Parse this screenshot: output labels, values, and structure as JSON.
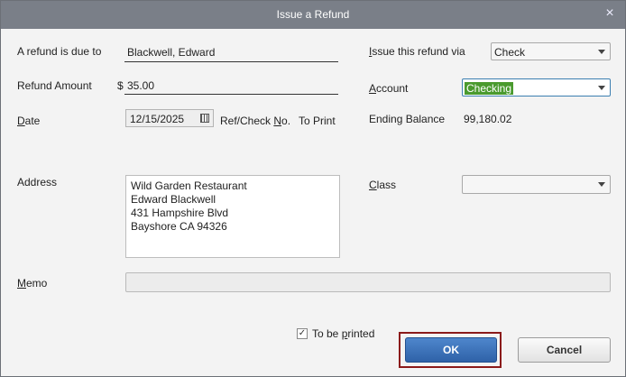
{
  "window": {
    "title": "Issue a Refund",
    "close_glyph": "×"
  },
  "form": {
    "refund_due_label": "A refund is due to",
    "refund_due_value": "Blackwell, Edward",
    "amount_label": "Refund Amount",
    "currency": "$",
    "amount_value": "35.00",
    "date_label_u": "D",
    "date_label_rest": "ate",
    "date_value": "12/15/2025",
    "ref_label_pre": "Ref/Check ",
    "ref_label_u": "N",
    "ref_label_post": "o.",
    "ref_value": "To Print",
    "address_label": "Address",
    "address_lines": [
      "Wild Garden Restaurant",
      "Edward Blackwell",
      "431 Hampshire Blvd",
      "Bayshore CA 94326"
    ],
    "memo_label_u": "M",
    "memo_label_rest": "emo",
    "memo_value": "",
    "issue_via_label_u": "I",
    "issue_via_label_rest": "ssue this refund via",
    "issue_via_value": "Check",
    "account_label_u": "A",
    "account_label_rest": "ccount",
    "account_value": "Checking",
    "ending_balance_label": "Ending Balance",
    "ending_balance_value": "99,180.02",
    "class_label_u": "C",
    "class_label_rest": "lass",
    "class_value": "",
    "to_be_printed_pre": "To be ",
    "to_be_printed_u": "p",
    "to_be_printed_post": "rinted",
    "to_be_printed_checked": true
  },
  "buttons": {
    "ok": "OK",
    "cancel": "Cancel"
  },
  "colors": {
    "titlebar": "#7a7f88",
    "ok_button": "#3a6fb8",
    "highlight_border": "#8b1a1a",
    "account_highlight": "#4a9a2e"
  },
  "icons": [
    "close-icon",
    "calendar-icon",
    "dropdown-arrow-icon",
    "checkbox-icon"
  ]
}
